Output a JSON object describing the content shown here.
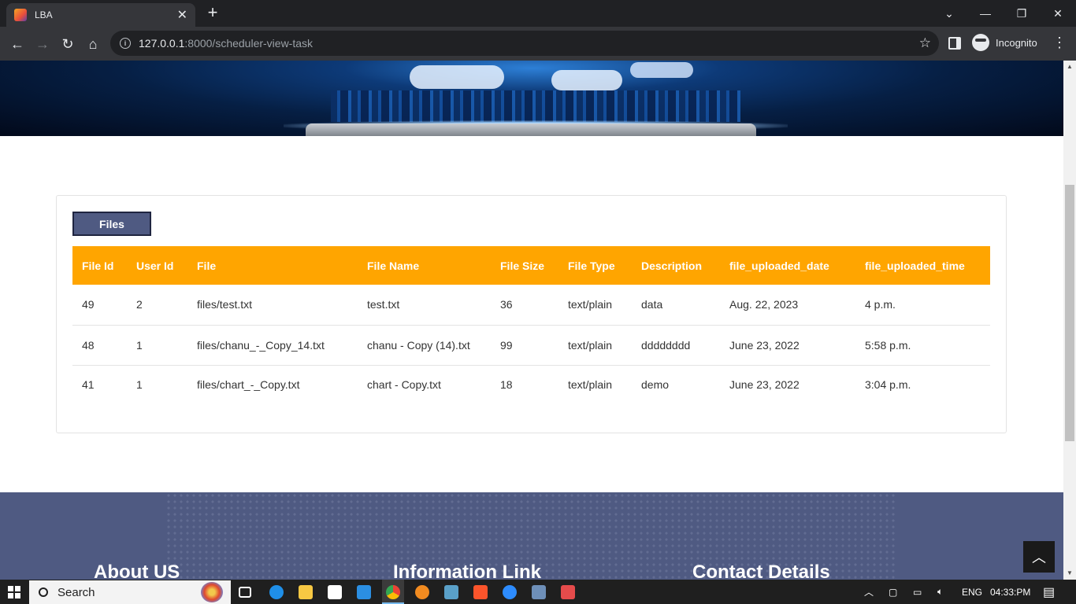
{
  "browser": {
    "tab_title": "LBA",
    "url_host": "127.0.0.1",
    "url_path": ":8000/scheduler-view-task",
    "profile_label": "Incognito"
  },
  "card": {
    "files_button": "Files",
    "table": {
      "headers": [
        "File Id",
        "User Id",
        "File",
        "File Name",
        "File Size",
        "File Type",
        "Description",
        "file_uploaded_date",
        "file_uploaded_time"
      ],
      "rows": [
        [
          "49",
          "2",
          "files/test.txt",
          "test.txt",
          "36",
          "text/plain",
          "data",
          "Aug. 22, 2023",
          "4 p.m."
        ],
        [
          "48",
          "1",
          "files/chanu_-_Copy_14.txt",
          "chanu - Copy (14).txt",
          "99",
          "text/plain",
          "dddddddd",
          "June 23, 2022",
          "5:58 p.m."
        ],
        [
          "41",
          "1",
          "files/chart_-_Copy.txt",
          "chart - Copy.txt",
          "18",
          "text/plain",
          "demo",
          "June 23, 2022",
          "3:04 p.m."
        ]
      ]
    }
  },
  "footer": {
    "about": "About US",
    "info": "Information Link",
    "contact": "Contact Details"
  },
  "taskbar": {
    "search_label": "Search",
    "language": "ENG",
    "time": "04:33:PM"
  },
  "colors": {
    "table_header": "#ffa500",
    "files_button": "#4f5a82",
    "footer_bg": "#4f5a82"
  }
}
